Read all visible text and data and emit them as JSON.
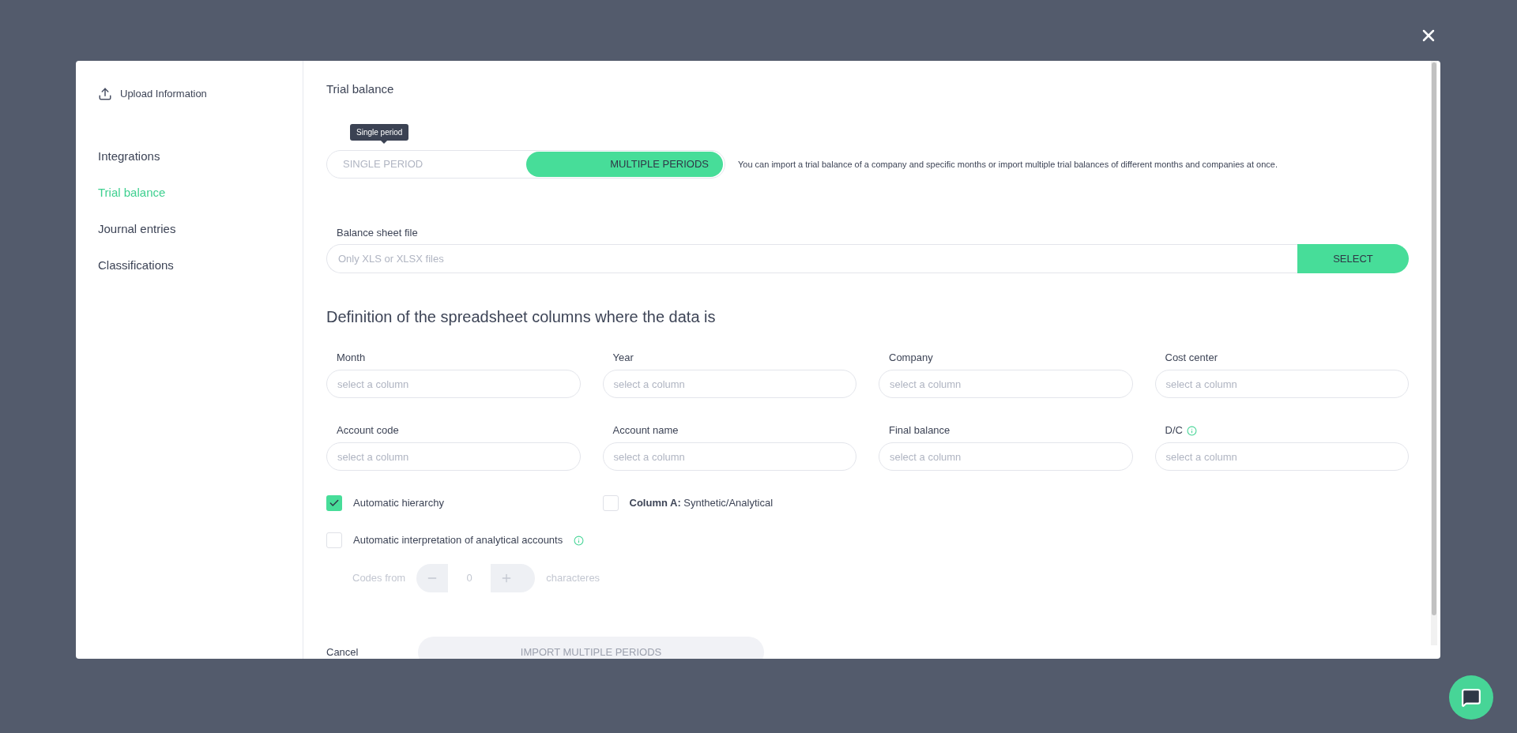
{
  "sidebar": {
    "header": "Upload Information",
    "items": [
      {
        "label": "Integrations",
        "selected": false
      },
      {
        "label": "Trial balance",
        "selected": true
      },
      {
        "label": "Journal entries",
        "selected": false
      },
      {
        "label": "Classifications",
        "selected": false
      }
    ]
  },
  "main": {
    "title": "Trial balance",
    "mode_tooltip": "Single period",
    "mode_toggle": [
      {
        "label": "SINGLE PERIOD",
        "selected": false
      },
      {
        "label": "MULTIPLE PERIODS",
        "selected": true
      }
    ],
    "mode_description": "You can import a trial balance of a company and specific months or import multiple trial balances of different months and companies at once.",
    "file": {
      "label": "Balance sheet file",
      "placeholder": "Only XLS or XLSX files",
      "button": "SELECT"
    },
    "columns_heading": "Definition of the spreadsheet columns where the data is",
    "column_fields": [
      {
        "label": "Month",
        "placeholder": "select a column",
        "info": false
      },
      {
        "label": "Year",
        "placeholder": "select a column",
        "info": false
      },
      {
        "label": "Company",
        "placeholder": "select a column",
        "info": false
      },
      {
        "label": "Cost center",
        "placeholder": "select a column",
        "info": false
      },
      {
        "label": "Account code",
        "placeholder": "select a column",
        "info": false
      },
      {
        "label": "Account name",
        "placeholder": "select a column",
        "info": false
      },
      {
        "label": "Final balance",
        "placeholder": "select a column",
        "info": false
      },
      {
        "label": "D/C",
        "placeholder": "select a column",
        "info": true
      }
    ],
    "option_rows": [
      {
        "items": [
          {
            "label": "Automatic hierarchy",
            "checked": true,
            "info": false
          },
          {
            "label": "**Column A:** Synthetic/Analytical",
            "checked": false,
            "info": false
          }
        ]
      },
      {
        "items": [
          {
            "label": "Automatic interpretation of analytical accounts",
            "checked": false,
            "info": true
          }
        ]
      }
    ],
    "codes": {
      "label": "Codes from",
      "value": "0",
      "suffix": "characteres",
      "disabled": true
    },
    "actions": {
      "cancel": "Cancel",
      "submit": "IMPORT MULTIPLE PERIODS",
      "submit_disabled": true
    }
  }
}
